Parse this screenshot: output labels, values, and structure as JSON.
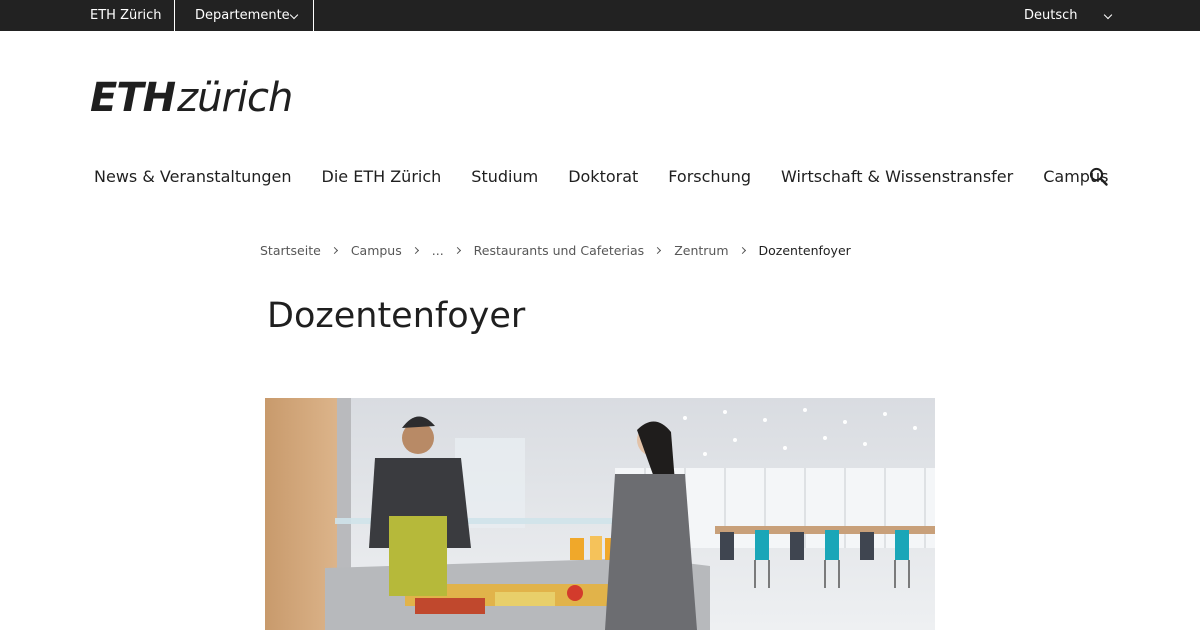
{
  "topbar": {
    "eth_link": "ETH Zürich",
    "departments_label": "Departemente",
    "language_label": "Deutsch"
  },
  "logo": {
    "eth": "ETH",
    "zurich": "zürich"
  },
  "main_nav": {
    "items": [
      {
        "label": "News & Veranstaltungen"
      },
      {
        "label": "Die ETH Zürich"
      },
      {
        "label": "Studium"
      },
      {
        "label": "Doktorat"
      },
      {
        "label": "Forschung"
      },
      {
        "label": "Wirtschaft & Wissenstransfer"
      },
      {
        "label": "Campus"
      }
    ],
    "search_icon": "search-icon"
  },
  "breadcrumb": {
    "items": [
      {
        "label": "Startseite"
      },
      {
        "label": "Campus"
      },
      {
        "label": "..."
      },
      {
        "label": "Restaurants und Cafeterias"
      },
      {
        "label": "Zentrum"
      },
      {
        "label": "Dozentenfoyer"
      }
    ]
  },
  "page": {
    "title": "Dozentenfoyer"
  },
  "colors": {
    "topbar_bg": "#222222",
    "text": "#1f1f1f",
    "breadcrumb_text": "#575757",
    "chair_accent": "#1aa6b8"
  }
}
